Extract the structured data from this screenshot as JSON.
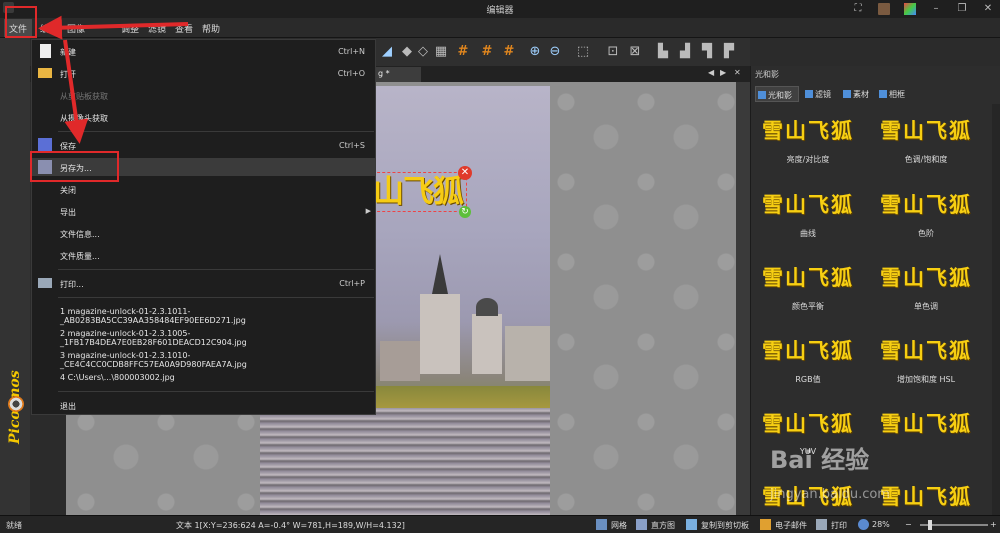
{
  "window": {
    "title": "编辑器"
  },
  "menubar": {
    "items": [
      {
        "label": "文件"
      },
      {
        "label": "编辑"
      },
      {
        "label": "图像"
      },
      {
        "label": "调整"
      },
      {
        "label": "滤镜"
      },
      {
        "label": "查看"
      },
      {
        "label": "帮助"
      }
    ]
  },
  "file_menu": {
    "items": [
      {
        "label": "新建",
        "shortcut": "Ctrl+N",
        "icon": "new-document-icon"
      },
      {
        "label": "打开",
        "shortcut": "Ctrl+O",
        "icon": "folder-open-icon"
      },
      {
        "label": "从剪贴板获取",
        "disabled": true
      },
      {
        "label": "从摄像头获取"
      },
      {
        "label": "保存",
        "shortcut": "Ctrl+S",
        "icon": "save-icon"
      },
      {
        "label": "另存为...",
        "icon": "save-as-icon",
        "highlighted": true
      },
      {
        "label": "关闭"
      },
      {
        "label": "导出",
        "submenu": true
      },
      {
        "label": "文件信息..."
      },
      {
        "label": "文件质量..."
      },
      {
        "label": "打印...",
        "shortcut": "Ctrl+P",
        "icon": "printer-icon"
      },
      {
        "label": "1 magazine-unlock-01-2.3.1011-_AB0283BA5CC39AA358484EF90EE6D271.jpg"
      },
      {
        "label": "2 magazine-unlock-01-2.3.1005-_1FB17B4DEA7E0EB28F601DEACD12C904.jpg"
      },
      {
        "label": "3 magazine-unlock-01-2.3.1010-_CE4C4CC0CDB8FFC57EA0A9D980FAEA7A.jpg"
      },
      {
        "label": "4 C:\\Users\\...\\800003002.jpg"
      },
      {
        "label": "退出"
      }
    ]
  },
  "document": {
    "tab_label": "g *",
    "overlay_text": "山飞狐"
  },
  "side_brand": {
    "logo_text": "Picosmos"
  },
  "right_panel": {
    "title": "光和影",
    "tabs": [
      {
        "label": "光和影",
        "active": true
      },
      {
        "label": "滤镜"
      },
      {
        "label": "素材"
      },
      {
        "label": "相框"
      }
    ],
    "sample_text": "雪山飞狐",
    "effects": [
      {
        "label": "亮度/对比度"
      },
      {
        "label": "色调/饱和度"
      },
      {
        "label": "曲线"
      },
      {
        "label": "色阶"
      },
      {
        "label": "颜色平衡"
      },
      {
        "label": "单色调"
      },
      {
        "label": "RGB值"
      },
      {
        "label": "增加饱和度 HSL"
      },
      {
        "label": "YUV"
      },
      {
        "label": ""
      }
    ]
  },
  "statusbar": {
    "status": "就绪",
    "info": "文本 1[X:Y=236:624 A=-0.4° W=781,H=189,W/H=4.132]",
    "grid": "网格",
    "histogram": "直方图",
    "copy": "复制到剪切板",
    "email": "电子邮件",
    "print": "打印",
    "zoom": "28%"
  },
  "watermark": {
    "brand": "Bai 经验",
    "url": "jingyan.baidu.com"
  }
}
